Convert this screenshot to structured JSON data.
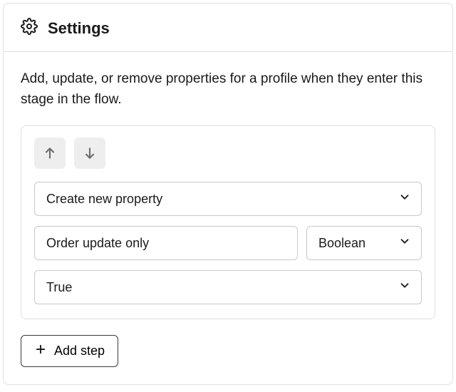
{
  "header": {
    "title": "Settings"
  },
  "description": "Add, update, or remove properties for a profile when they enter this stage in the flow.",
  "step": {
    "action": "Create new property",
    "property_name": "Order update only",
    "property_type": "Boolean",
    "value": "True"
  },
  "buttons": {
    "add_step": "Add step"
  }
}
